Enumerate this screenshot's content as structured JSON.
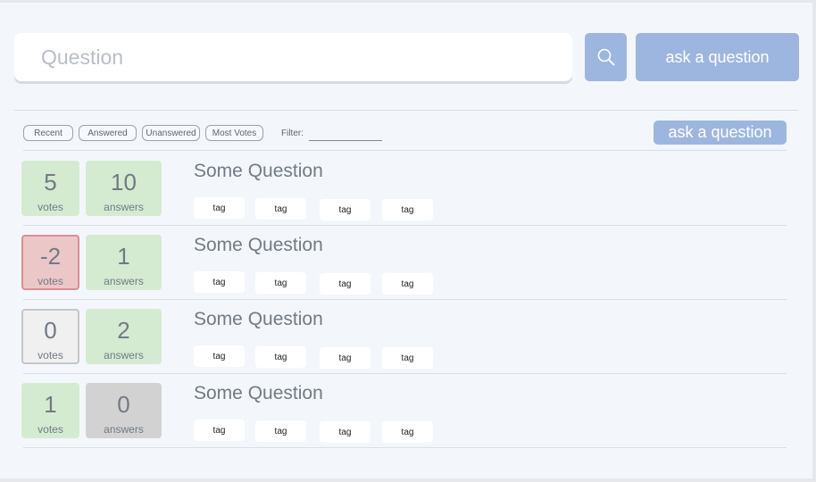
{
  "search": {
    "placeholder": "Question",
    "value": ""
  },
  "header": {
    "search_icon": "search-icon",
    "ask_label": "ask a question"
  },
  "filters": {
    "buttons": [
      "Recent",
      "Answered",
      "Unanswered",
      "Most Votes"
    ],
    "filter_label": "Filter:",
    "filter_value": "",
    "ask_label": "ask a question"
  },
  "colors": {
    "accent": "#9db6df",
    "positive": "#d5ebd1",
    "negative": "#ecc7c8",
    "neutral": "#f0f0f0",
    "unanswered": "#d2d2d2"
  },
  "questions": [
    {
      "title": "Some Question",
      "votes": "5",
      "votes_label": "votes",
      "answers": "10",
      "answers_label": "answers",
      "tags": [
        "tag",
        "tag",
        "tag",
        "tag"
      ]
    },
    {
      "title": "Some Question",
      "votes": "-2",
      "votes_label": "votes",
      "answers": "1",
      "answers_label": "answers",
      "tags": [
        "tag",
        "tag",
        "tag",
        "tag"
      ]
    },
    {
      "title": "Some Question",
      "votes": "0",
      "votes_label": "votes",
      "answers": "2",
      "answers_label": "answers",
      "tags": [
        "tag",
        "tag",
        "tag",
        "tag"
      ]
    },
    {
      "title": "Some Question",
      "votes": "1",
      "votes_label": "votes",
      "answers": "0",
      "answers_label": "answers",
      "tags": [
        "tag",
        "tag",
        "tag",
        "tag"
      ]
    }
  ]
}
